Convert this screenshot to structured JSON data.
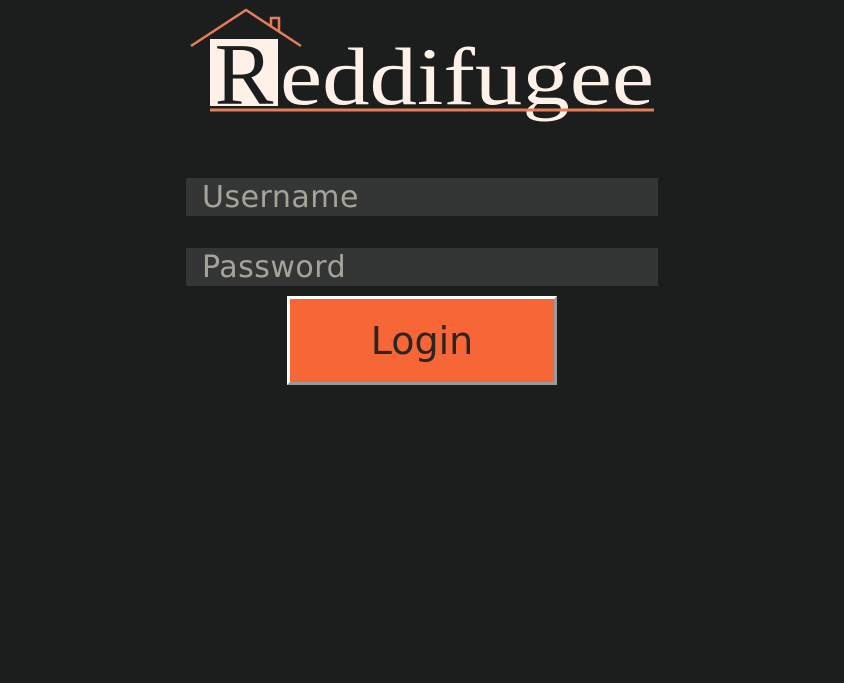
{
  "logo": {
    "initial": "R",
    "rest": "eddifugee"
  },
  "login_form": {
    "username_placeholder": "Username",
    "password_placeholder": "Password",
    "login_label": "Login"
  },
  "colors": {
    "background": "#1c1e1d",
    "accent": "#f76637",
    "house_outline": "#e67d5a",
    "logo_cream": "#fff1e8",
    "field_background": "#333634",
    "placeholder_text": "#a6a399"
  }
}
